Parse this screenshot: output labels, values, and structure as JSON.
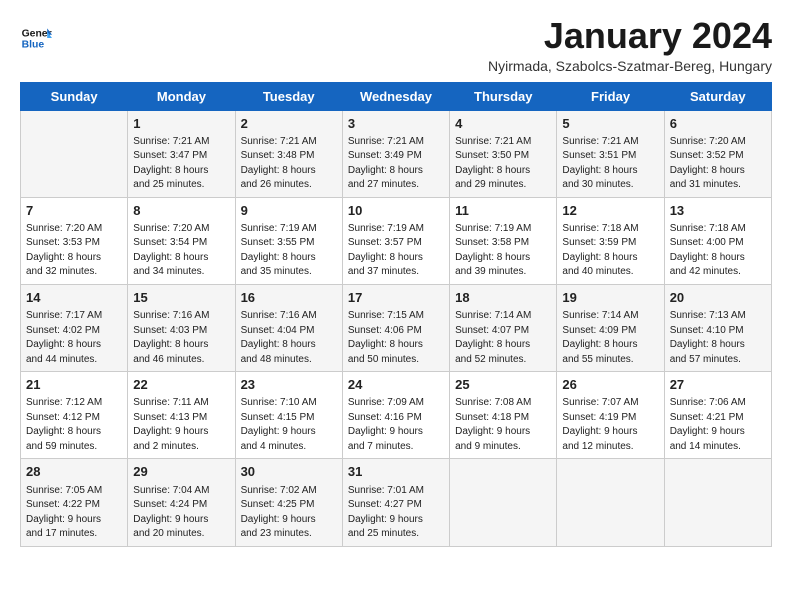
{
  "logo": {
    "text_general": "General",
    "text_blue": "Blue"
  },
  "header": {
    "month_title": "January 2024",
    "subtitle": "Nyirmada, Szabolcs-Szatmar-Bereg, Hungary"
  },
  "weekdays": [
    "Sunday",
    "Monday",
    "Tuesday",
    "Wednesday",
    "Thursday",
    "Friday",
    "Saturday"
  ],
  "weeks": [
    [
      {
        "day": "",
        "content": ""
      },
      {
        "day": "1",
        "content": "Sunrise: 7:21 AM\nSunset: 3:47 PM\nDaylight: 8 hours\nand 25 minutes."
      },
      {
        "day": "2",
        "content": "Sunrise: 7:21 AM\nSunset: 3:48 PM\nDaylight: 8 hours\nand 26 minutes."
      },
      {
        "day": "3",
        "content": "Sunrise: 7:21 AM\nSunset: 3:49 PM\nDaylight: 8 hours\nand 27 minutes."
      },
      {
        "day": "4",
        "content": "Sunrise: 7:21 AM\nSunset: 3:50 PM\nDaylight: 8 hours\nand 29 minutes."
      },
      {
        "day": "5",
        "content": "Sunrise: 7:21 AM\nSunset: 3:51 PM\nDaylight: 8 hours\nand 30 minutes."
      },
      {
        "day": "6",
        "content": "Sunrise: 7:20 AM\nSunset: 3:52 PM\nDaylight: 8 hours\nand 31 minutes."
      }
    ],
    [
      {
        "day": "7",
        "content": "Sunrise: 7:20 AM\nSunset: 3:53 PM\nDaylight: 8 hours\nand 32 minutes."
      },
      {
        "day": "8",
        "content": "Sunrise: 7:20 AM\nSunset: 3:54 PM\nDaylight: 8 hours\nand 34 minutes."
      },
      {
        "day": "9",
        "content": "Sunrise: 7:19 AM\nSunset: 3:55 PM\nDaylight: 8 hours\nand 35 minutes."
      },
      {
        "day": "10",
        "content": "Sunrise: 7:19 AM\nSunset: 3:57 PM\nDaylight: 8 hours\nand 37 minutes."
      },
      {
        "day": "11",
        "content": "Sunrise: 7:19 AM\nSunset: 3:58 PM\nDaylight: 8 hours\nand 39 minutes."
      },
      {
        "day": "12",
        "content": "Sunrise: 7:18 AM\nSunset: 3:59 PM\nDaylight: 8 hours\nand 40 minutes."
      },
      {
        "day": "13",
        "content": "Sunrise: 7:18 AM\nSunset: 4:00 PM\nDaylight: 8 hours\nand 42 minutes."
      }
    ],
    [
      {
        "day": "14",
        "content": "Sunrise: 7:17 AM\nSunset: 4:02 PM\nDaylight: 8 hours\nand 44 minutes."
      },
      {
        "day": "15",
        "content": "Sunrise: 7:16 AM\nSunset: 4:03 PM\nDaylight: 8 hours\nand 46 minutes."
      },
      {
        "day": "16",
        "content": "Sunrise: 7:16 AM\nSunset: 4:04 PM\nDaylight: 8 hours\nand 48 minutes."
      },
      {
        "day": "17",
        "content": "Sunrise: 7:15 AM\nSunset: 4:06 PM\nDaylight: 8 hours\nand 50 minutes."
      },
      {
        "day": "18",
        "content": "Sunrise: 7:14 AM\nSunset: 4:07 PM\nDaylight: 8 hours\nand 52 minutes."
      },
      {
        "day": "19",
        "content": "Sunrise: 7:14 AM\nSunset: 4:09 PM\nDaylight: 8 hours\nand 55 minutes."
      },
      {
        "day": "20",
        "content": "Sunrise: 7:13 AM\nSunset: 4:10 PM\nDaylight: 8 hours\nand 57 minutes."
      }
    ],
    [
      {
        "day": "21",
        "content": "Sunrise: 7:12 AM\nSunset: 4:12 PM\nDaylight: 8 hours\nand 59 minutes."
      },
      {
        "day": "22",
        "content": "Sunrise: 7:11 AM\nSunset: 4:13 PM\nDaylight: 9 hours\nand 2 minutes."
      },
      {
        "day": "23",
        "content": "Sunrise: 7:10 AM\nSunset: 4:15 PM\nDaylight: 9 hours\nand 4 minutes."
      },
      {
        "day": "24",
        "content": "Sunrise: 7:09 AM\nSunset: 4:16 PM\nDaylight: 9 hours\nand 7 minutes."
      },
      {
        "day": "25",
        "content": "Sunrise: 7:08 AM\nSunset: 4:18 PM\nDaylight: 9 hours\nand 9 minutes."
      },
      {
        "day": "26",
        "content": "Sunrise: 7:07 AM\nSunset: 4:19 PM\nDaylight: 9 hours\nand 12 minutes."
      },
      {
        "day": "27",
        "content": "Sunrise: 7:06 AM\nSunset: 4:21 PM\nDaylight: 9 hours\nand 14 minutes."
      }
    ],
    [
      {
        "day": "28",
        "content": "Sunrise: 7:05 AM\nSunset: 4:22 PM\nDaylight: 9 hours\nand 17 minutes."
      },
      {
        "day": "29",
        "content": "Sunrise: 7:04 AM\nSunset: 4:24 PM\nDaylight: 9 hours\nand 20 minutes."
      },
      {
        "day": "30",
        "content": "Sunrise: 7:02 AM\nSunset: 4:25 PM\nDaylight: 9 hours\nand 23 minutes."
      },
      {
        "day": "31",
        "content": "Sunrise: 7:01 AM\nSunset: 4:27 PM\nDaylight: 9 hours\nand 25 minutes."
      },
      {
        "day": "",
        "content": ""
      },
      {
        "day": "",
        "content": ""
      },
      {
        "day": "",
        "content": ""
      }
    ]
  ]
}
